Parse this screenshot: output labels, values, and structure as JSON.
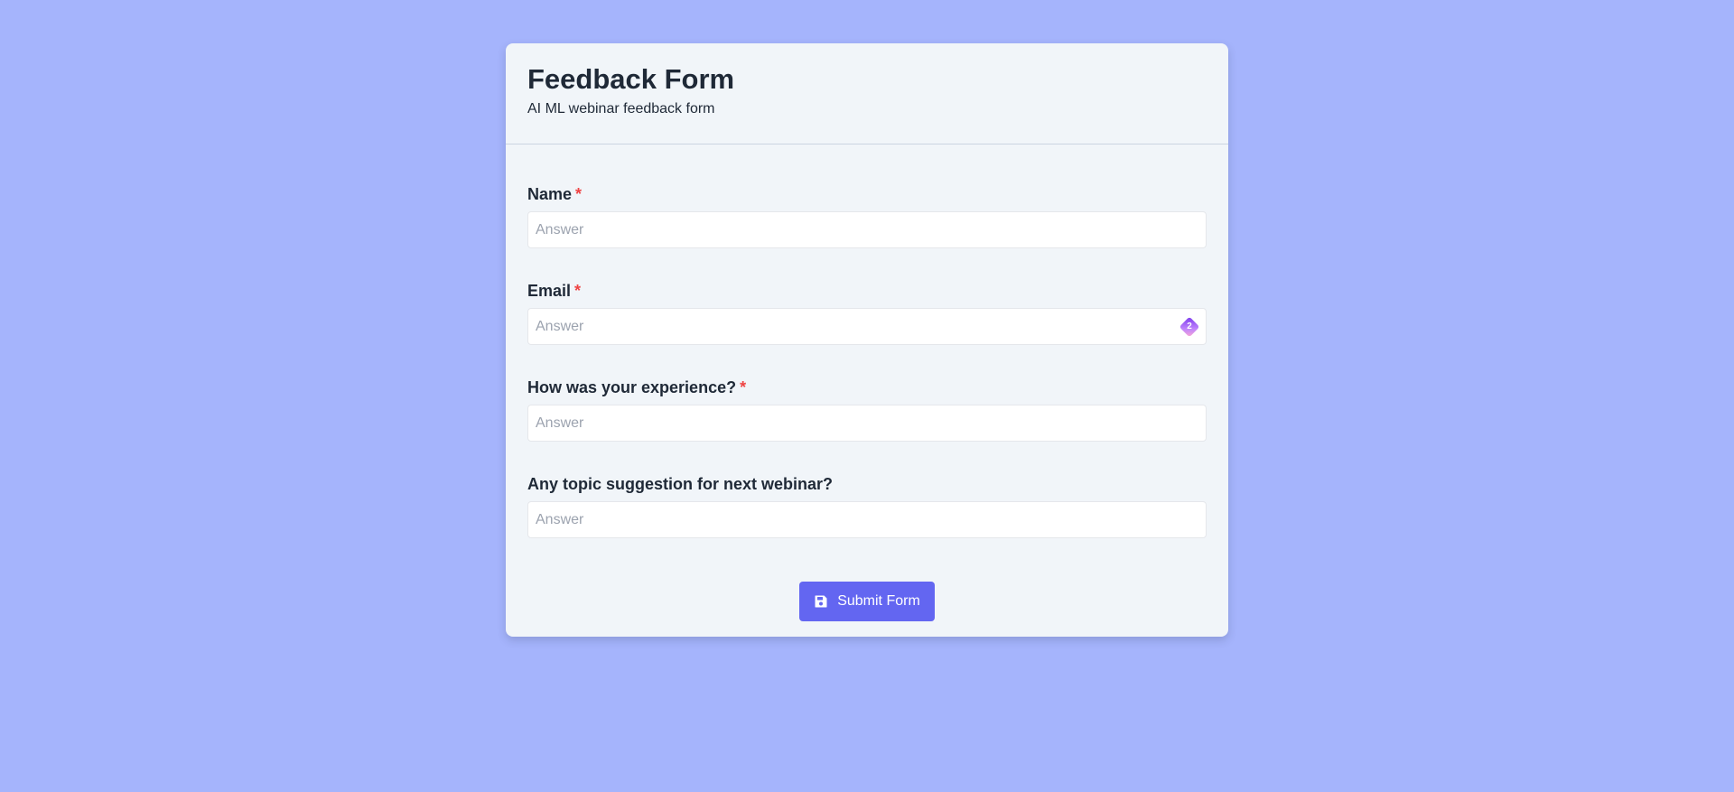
{
  "form": {
    "title": "Feedback Form",
    "subtitle": "AI ML webinar feedback form"
  },
  "fields": [
    {
      "label": "Name",
      "required_mark": "*",
      "placeholder": "Answer",
      "value": ""
    },
    {
      "label": "Email",
      "required_mark": "*",
      "placeholder": "Answer",
      "value": "",
      "extension_badge": {
        "icon": "password-manager-icon",
        "count": "2"
      }
    },
    {
      "label": "How was your experience?",
      "required_mark": "*",
      "placeholder": "Answer",
      "value": ""
    },
    {
      "label": "Any topic suggestion for next webinar?",
      "placeholder": "Answer",
      "value": ""
    }
  ],
  "submit": {
    "label": "Submit Form",
    "icon": "save-icon"
  },
  "colors": {
    "background": "#a5b4fc",
    "card": "#f1f5f9",
    "accent": "#6366f1",
    "required": "#ef4444"
  }
}
